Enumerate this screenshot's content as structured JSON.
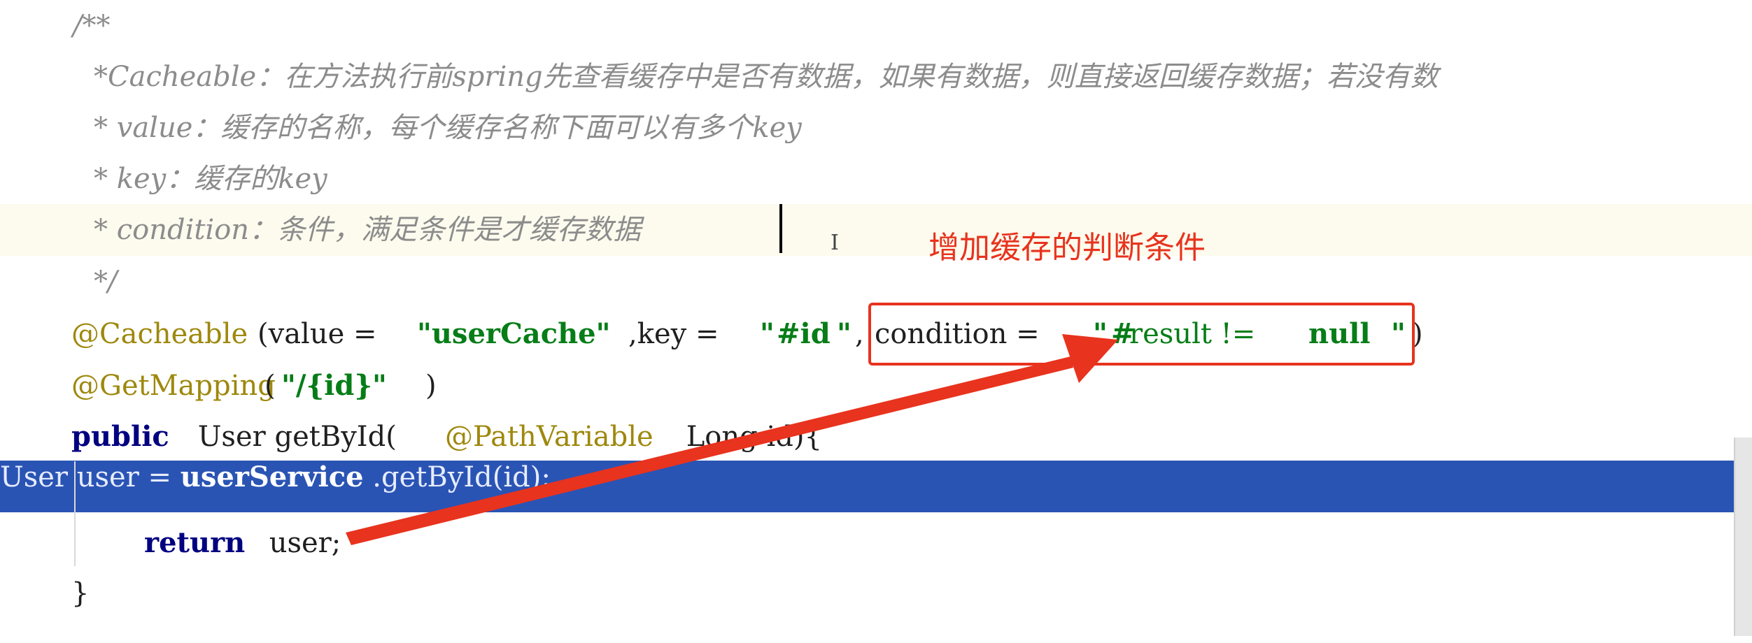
{
  "editor": {
    "lines": [
      {
        "indent": "",
        "text": "/**"
      },
      {
        "text": "*Cacheable：在方法执行前spring先查看缓存中是否有数据，如果有数据，则直接返回缓存数据；若没有数"
      },
      {
        "text": "* value：缓存的名称，每个缓存名称下面可以有多个key"
      },
      {
        "text": "* key：缓存的key"
      },
      {
        "text": "* condition：条件，满足条件是才缓存数据"
      },
      {
        "text": "*/"
      }
    ],
    "annotation1": {
      "name": "@Cacheable",
      "open": "(value = ",
      "v1": "\"userCache\"",
      "mid": ",key = ",
      "v2q1": "\"",
      "v2": "#id",
      "v2q2": "\"",
      "comma": ",",
      "cond": "condition = ",
      "v3q1": "\"",
      "v3hash": "#",
      "v3a": "result != ",
      "v3null": "null",
      "v3q2": "\"",
      "close": ")"
    },
    "annotation2": {
      "name": "@GetMapping",
      "open": "(",
      "value": "\"/{id}\"",
      "close": ")"
    },
    "method": {
      "kw": "public",
      "sig1": " User getById(",
      "param_ann": "@PathVariable",
      "sig2": " Long id){"
    },
    "body": {
      "line1_a": "User user = ",
      "line1_b": "userService",
      "line1_c": ".getById(id);",
      "line2_kw": "return",
      "line2_rest": " user;",
      "close_brace": "}"
    }
  },
  "overlay": {
    "label": "增加缓存的判断条件",
    "color": "#e8331e"
  },
  "colors": {
    "selection": "#2a54b4",
    "current_line": "#fdfbee",
    "comment": "#8c8c8c",
    "annotation": "#9e880d",
    "keyword": "#000080",
    "string": "#067d17"
  }
}
